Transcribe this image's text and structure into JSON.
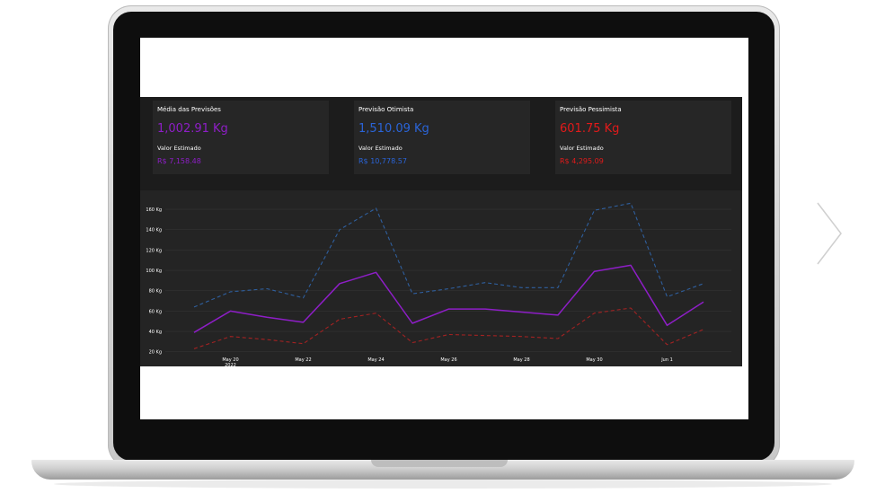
{
  "cards": [
    {
      "title": "Média das Previsões",
      "value": "1,002.91 Kg",
      "label": "Valor Estimado",
      "price": "R$ 7,158.48",
      "color": "#8e1ec7"
    },
    {
      "title": "Previsão Otimista",
      "value": "1,510.09 Kg",
      "label": "Valor Estimado",
      "price": "R$ 10,778.57",
      "color": "#2a64d8"
    },
    {
      "title": "Previsão Pessimista",
      "value": "601.75 Kg",
      "label": "Valor Estimado",
      "price": "R$ 4,295.09",
      "color": "#e21a1a"
    }
  ],
  "chart_data": {
    "type": "line",
    "x": [
      "2022-05-19",
      "2022-05-20",
      "2022-05-21",
      "2022-05-22",
      "2022-05-23",
      "2022-05-24",
      "2022-05-25",
      "2022-05-26",
      "2022-05-27",
      "2022-05-28",
      "2022-05-29",
      "2022-05-30",
      "2022-05-31",
      "2022-06-01",
      "2022-06-02"
    ],
    "x_tick_labels": [
      {
        "date": "2022-05-20",
        "label": "May 20",
        "sublabel": "2022"
      },
      {
        "date": "2022-05-22",
        "label": "May 22",
        "sublabel": ""
      },
      {
        "date": "2022-05-24",
        "label": "May 24",
        "sublabel": ""
      },
      {
        "date": "2022-05-26",
        "label": "May 26",
        "sublabel": ""
      },
      {
        "date": "2022-05-28",
        "label": "May 28",
        "sublabel": ""
      },
      {
        "date": "2022-05-30",
        "label": "May 30",
        "sublabel": ""
      },
      {
        "date": "2022-06-01",
        "label": "Jun 1",
        "sublabel": ""
      }
    ],
    "y_ticks": [
      20,
      40,
      60,
      80,
      100,
      120,
      140,
      160
    ],
    "y_tick_format": "{} Kg",
    "ylim": [
      18,
      168
    ],
    "grid": true,
    "series": [
      {
        "dash": true,
        "color": "#2f5f9e",
        "values": [
          64,
          79,
          82,
          73,
          140,
          161,
          77,
          82,
          88,
          83,
          83,
          159,
          166,
          74,
          87
        ]
      },
      {
        "dash": false,
        "color": "#8e1ec7",
        "values": [
          39,
          60,
          54,
          49,
          87,
          98,
          48,
          62,
          62,
          59,
          56,
          99,
          105,
          46,
          69
        ]
      },
      {
        "dash": true,
        "color": "#a32222",
        "values": [
          23,
          35,
          32,
          28,
          52,
          58,
          29,
          37,
          36,
          35,
          33,
          58,
          63,
          27,
          42
        ]
      }
    ]
  }
}
